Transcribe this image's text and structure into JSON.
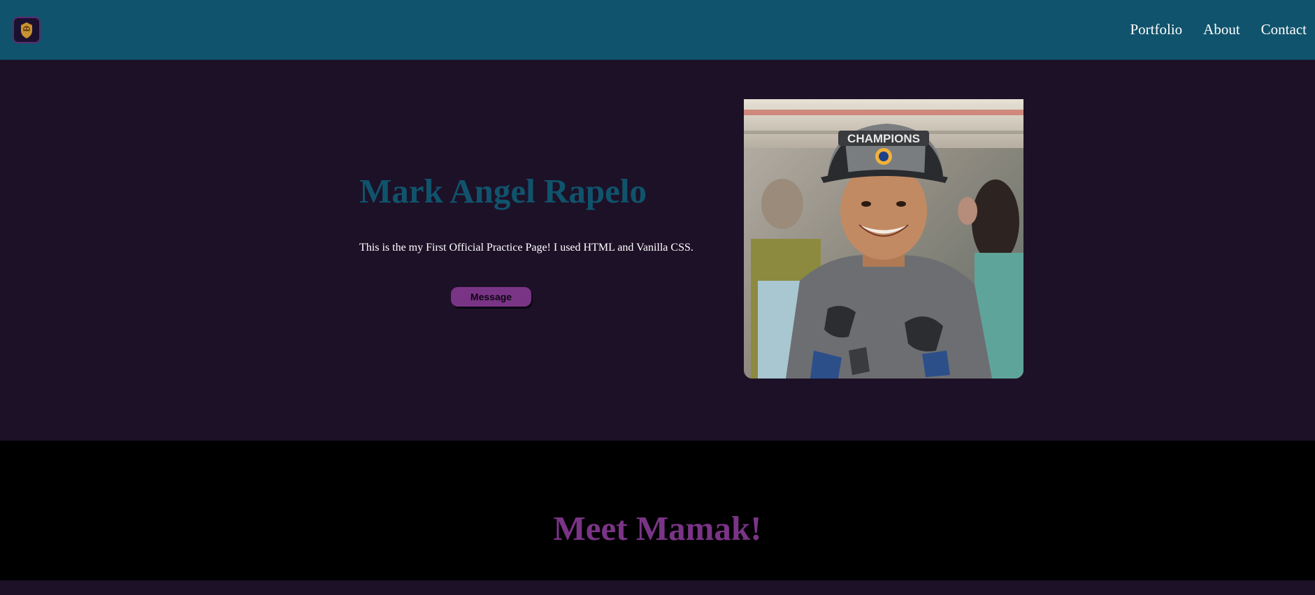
{
  "nav": {
    "logo_icon": "lion-crest-icon",
    "links": [
      "Portfolio",
      "About",
      "Contact"
    ]
  },
  "hero": {
    "name": "Mark Angel Rapelo",
    "description": "This is the my First Official Practice Page! I used HTML and Vanilla CSS.",
    "button_label": "Message",
    "photo_icon": "profile-photo"
  },
  "meet": {
    "title": "Meet Mamak!"
  },
  "colors": {
    "nav_bg": "#10536c",
    "page_bg": "#1d1127",
    "accent_purple": "#7a3486",
    "title_blue": "#10536c",
    "section_black": "#000000"
  }
}
